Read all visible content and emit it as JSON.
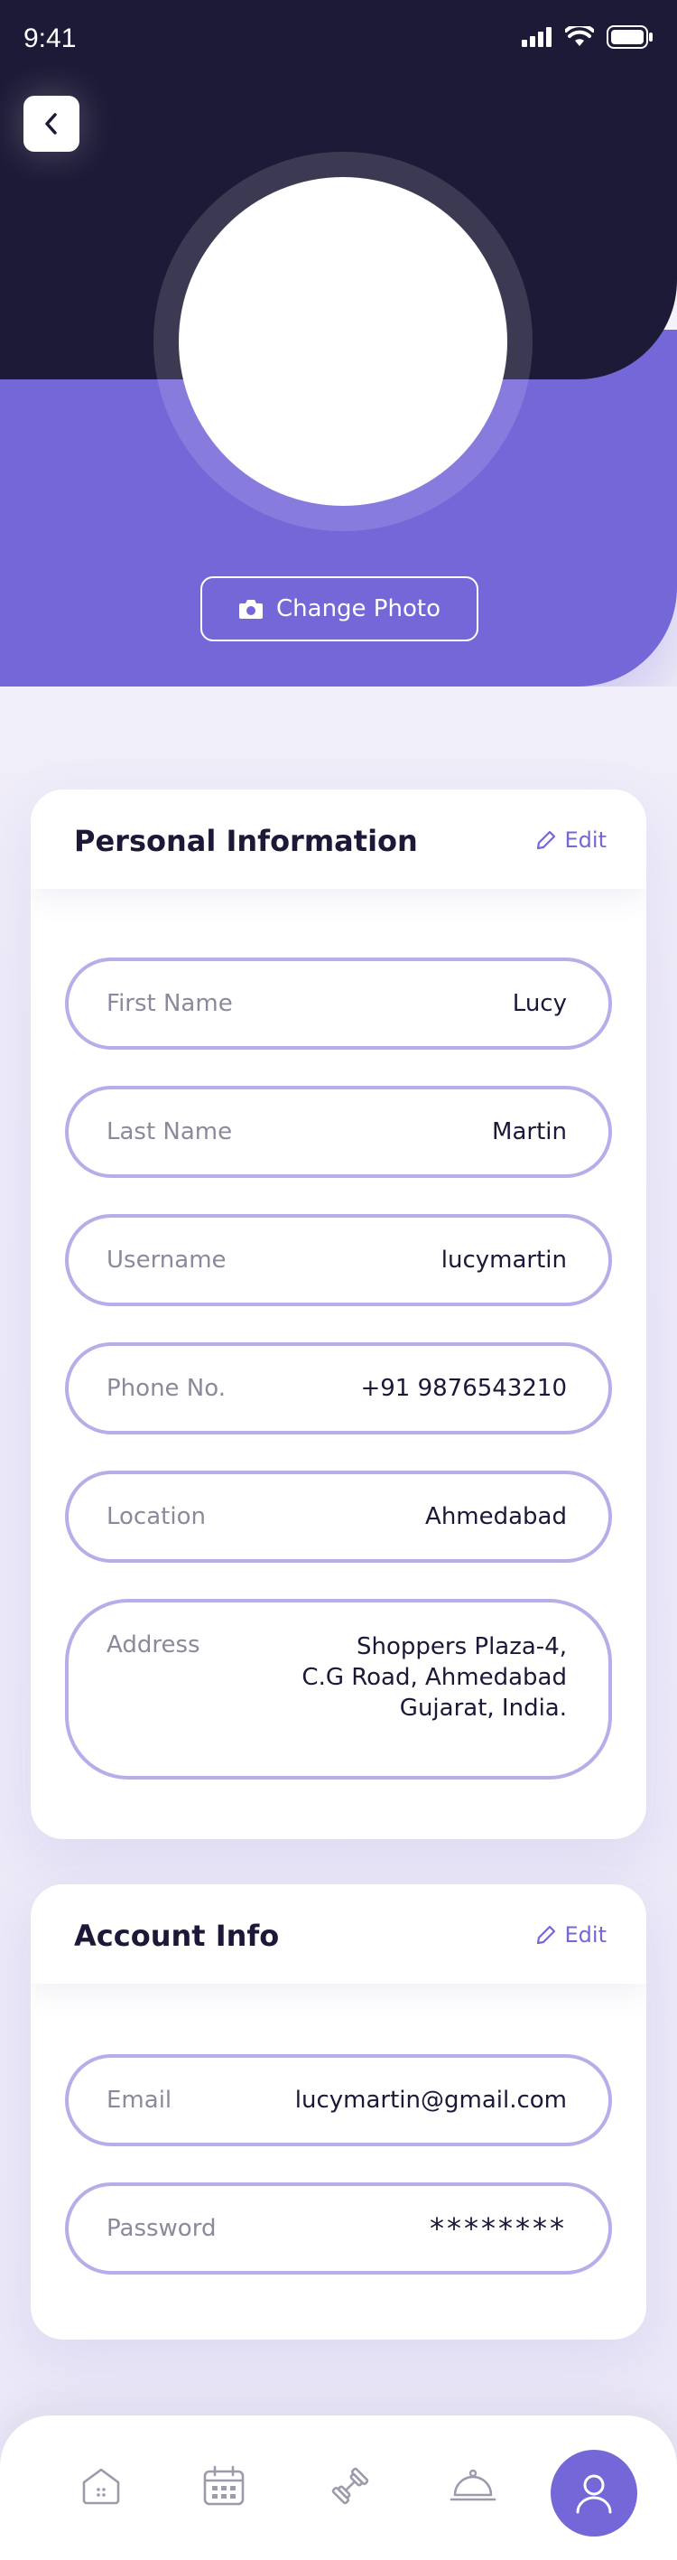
{
  "status": {
    "time": "9:41"
  },
  "header": {
    "change_photo_label": "Change Photo"
  },
  "personal": {
    "title": "Personal Information",
    "edit_label": "Edit",
    "fields": [
      {
        "label": "First Name",
        "value": "Lucy"
      },
      {
        "label": "Last Name",
        "value": "Martin"
      },
      {
        "label": "Username",
        "value": "lucymartin"
      },
      {
        "label": "Phone No.",
        "value": "+91 9876543210"
      },
      {
        "label": "Location",
        "value": "Ahmedabad"
      }
    ],
    "address": {
      "label": "Address",
      "lines": [
        "Shoppers Plaza-4,",
        "C.G Road, Ahmedabad",
        "Gujarat, India."
      ]
    }
  },
  "account": {
    "title": "Account Info",
    "edit_label": "Edit",
    "fields": [
      {
        "label": "Email",
        "value": "lucymartin@gmail.com"
      },
      {
        "label": "Password",
        "value": "********"
      }
    ]
  },
  "nav": {
    "items": [
      "home-icon",
      "calendar-icon",
      "dumbbell-icon",
      "cloche-icon",
      "profile-icon"
    ],
    "active": "profile-icon"
  },
  "colors": {
    "accent": "#7467d8",
    "dark": "#1c1a36",
    "field_border": "#b7aee9"
  }
}
